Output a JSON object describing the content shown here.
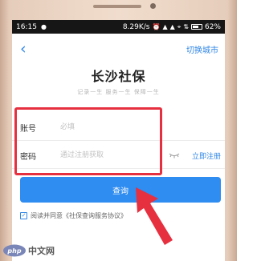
{
  "statusbar": {
    "time": "16:15",
    "left_icon": "video-camera-icon",
    "network_speed": "8.29K/s",
    "battery": "62%"
  },
  "navbar": {
    "back_icon": "chevron-left-icon",
    "switch_city": "切换城市"
  },
  "app": {
    "title": "长沙社保",
    "slogan": "记录一生  服务一生  保障一生"
  },
  "form": {
    "account_label": "账号",
    "account_placeholder": "必填",
    "password_label": "密码",
    "password_placeholder": "通过注册获取",
    "eye_icon": "eye-closed-icon",
    "register_link": "立即注册"
  },
  "query_button": "查询",
  "agreement": {
    "checked": true,
    "text": "阅读并同意《社保查询服务协议》"
  },
  "colors": {
    "accent": "#2f8cf0",
    "highlight": "#e62f3f",
    "arrow": "#e62f3f"
  },
  "watermark": {
    "logo_text": "php",
    "text": "中文网"
  }
}
